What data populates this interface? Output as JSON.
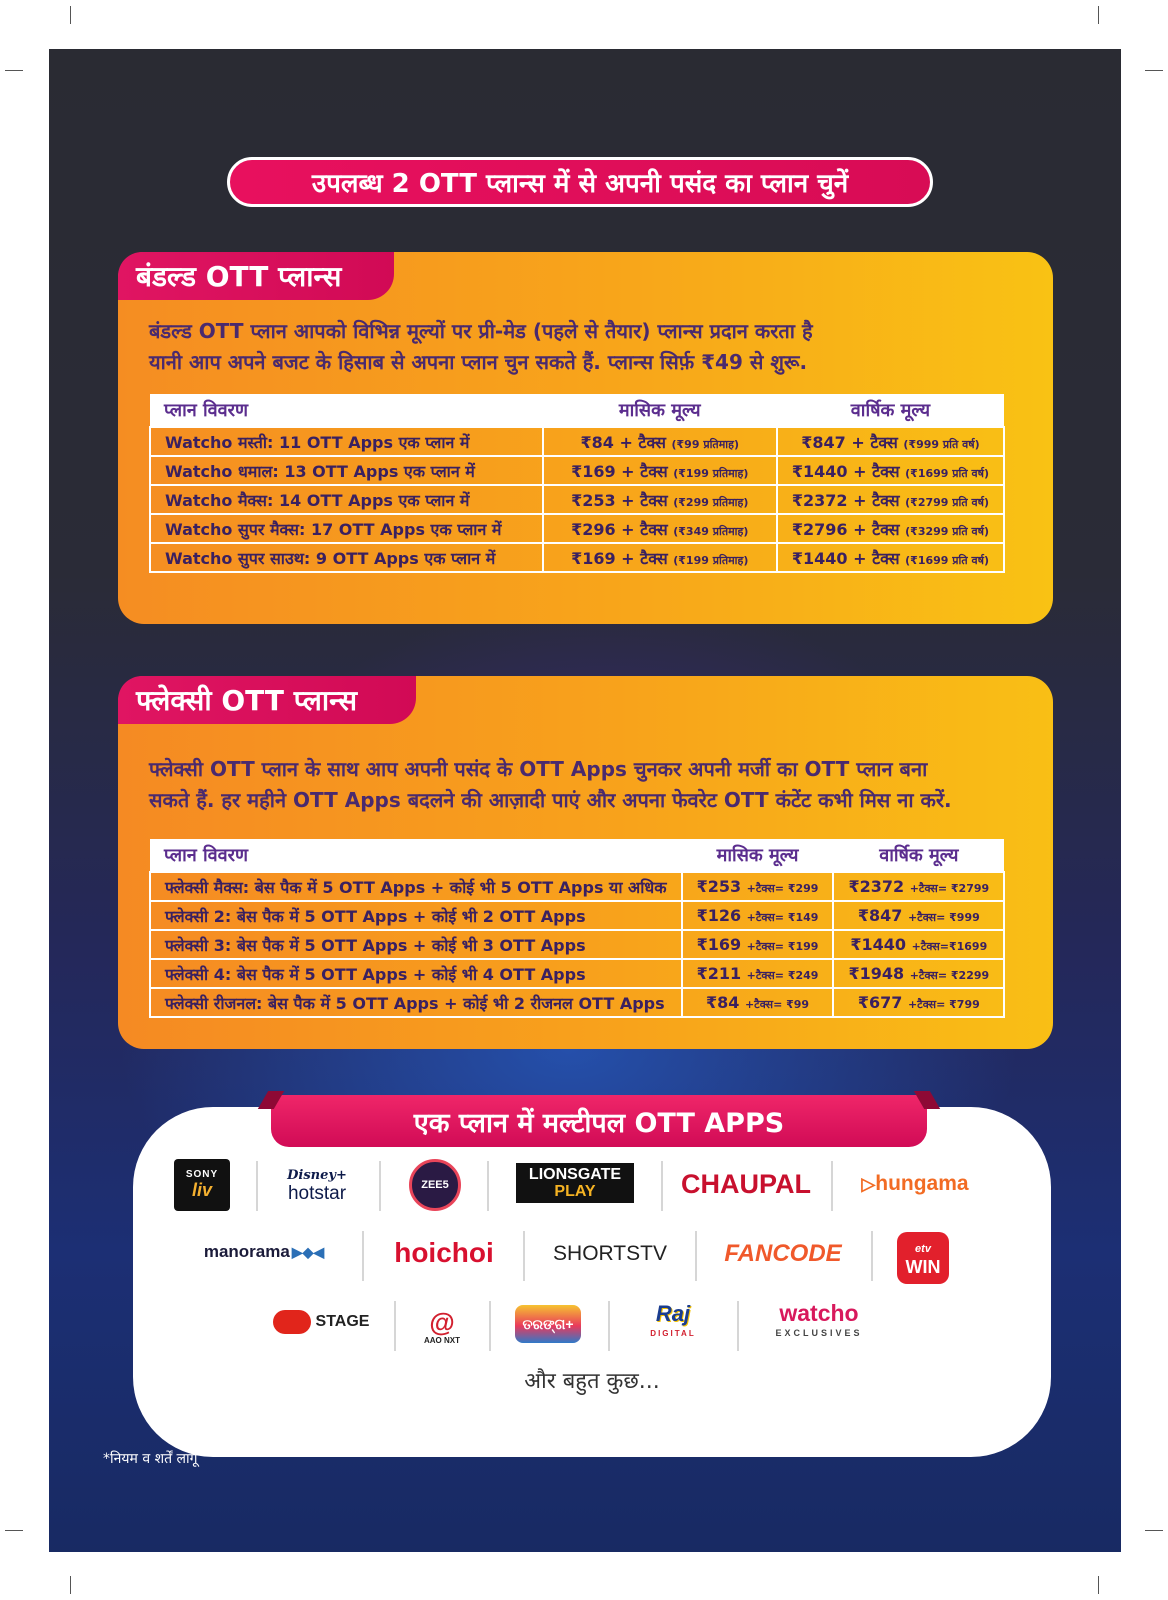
{
  "headline": "उपलब्ध 2 OTT प्लान्स में से अपनी पसंद का प्लान चुनें",
  "bundled": {
    "tag": "बंडल्ड OTT प्लान्स",
    "desc_line1": "बंडल्ड OTT प्लान आपको विभिन्न मूल्यों पर प्री-मेड (पहले से तैयार) प्लान्स प्रदान करता है",
    "desc_line2": "यानी आप अपने बजट के हिसाब से अपना प्लान चुन सकते हैं. प्लान्स सिर्फ़ ₹49 से शुरू.",
    "headers": [
      "प्लान विवरण",
      "मासिक मूल्य",
      "वार्षिक मूल्य"
    ],
    "rows": [
      {
        "plan": "Watcho मस्ती: 11 OTT Apps एक प्लान में",
        "monthly": "₹84 + टैक्स",
        "monthly_note": "(₹99 प्रतिमाह)",
        "yearly": "₹847 + टैक्स",
        "yearly_note": "(₹999 प्रति वर्ष)"
      },
      {
        "plan": "Watcho धमाल: 13 OTT Apps एक प्लान में",
        "monthly": "₹169 + टैक्स",
        "monthly_note": "(₹199 प्रतिमाह)",
        "yearly": "₹1440 + टैक्स",
        "yearly_note": "(₹1699 प्रति वर्ष)"
      },
      {
        "plan": "Watcho मैक्स: 14 OTT Apps एक प्लान में",
        "monthly": "₹253 + टैक्स",
        "monthly_note": "(₹299 प्रतिमाह)",
        "yearly": "₹2372 + टैक्स",
        "yearly_note": "(₹2799 प्रति वर्ष)"
      },
      {
        "plan": "Watcho सुपर मैक्स: 17 OTT Apps एक प्लान में",
        "monthly": "₹296 + टैक्स",
        "monthly_note": "(₹349 प्रतिमाह)",
        "yearly": "₹2796 + टैक्स",
        "yearly_note": "(₹3299 प्रति वर्ष)"
      },
      {
        "plan": "Watcho सुपर साउथ: 9 OTT Apps एक प्लान में",
        "monthly": "₹169 + टैक्स",
        "monthly_note": "(₹199 प्रतिमाह)",
        "yearly": "₹1440 + टैक्स",
        "yearly_note": "(₹1699 प्रति वर्ष)"
      }
    ]
  },
  "flexi": {
    "tag": "फ्लेक्सी OTT प्लान्स",
    "desc_line1": "फ्लेक्सी OTT प्लान के साथ आप अपनी पसंद के OTT Apps चुनकर अपनी मर्जी का OTT प्लान बना",
    "desc_line2": "सकते हैं. हर महीने OTT Apps बदलने की आज़ादी पाएं और अपना फेवरेट OTT कंटेंट कभी मिस ना करें.",
    "headers": [
      "प्लान विवरण",
      "मासिक मूल्य",
      "वार्षिक मूल्य"
    ],
    "rows": [
      {
        "plan": "फ्लेक्सी मैक्स: बेस पैक में 5 OTT Apps + कोई भी 5 OTT Apps या अधिक",
        "monthly": "₹253",
        "monthly_note": "+टैक्स= ₹299",
        "yearly": "₹2372",
        "yearly_note": "+टैक्स= ₹2799"
      },
      {
        "plan": "फ्लेक्सी 2: बेस पैक में 5 OTT Apps + कोई भी 2 OTT Apps",
        "monthly": "₹126",
        "monthly_note": "+टैक्स= ₹149",
        "yearly": "₹847",
        "yearly_note": "+टैक्स= ₹999"
      },
      {
        "plan": "फ्लेक्सी 3: बेस पैक में 5 OTT Apps + कोई भी 3 OTT Apps",
        "monthly": "₹169",
        "monthly_note": "+टैक्स= ₹199",
        "yearly": "₹1440",
        "yearly_note": "+टैक्स=₹1699"
      },
      {
        "plan": "फ्लेक्सी 4: बेस पैक में 5 OTT Apps + कोई भी 4 OTT Apps",
        "monthly": "₹211",
        "monthly_note": "+टैक्स= ₹249",
        "yearly": "₹1948",
        "yearly_note": "+टैक्स= ₹2299"
      },
      {
        "plan": "फ्लेक्सी रीजनल: बेस पैक में 5 OTT Apps + कोई भी 2 रीजनल OTT Apps",
        "monthly": "₹84",
        "monthly_note": "+टैक्स= ₹99",
        "yearly": "₹677",
        "yearly_note": "+टैक्स= ₹799"
      }
    ]
  },
  "apps": {
    "ribbon": "एक प्लान में मल्टीपल OTT APPS",
    "logos": {
      "sonyliv_top": "SONY",
      "sonyliv_bottom": "liv",
      "hotstar_top": "Disney+",
      "hotstar_bottom": "hotstar",
      "zee5": "ZEE5",
      "lionsgate_top": "LIONSGATE",
      "lionsgate_bottom": "PLAY",
      "chaupal": "CHAUPAL",
      "hungama": "hungama",
      "manorama": "manorama",
      "hoichoi": "hoichoi",
      "shortstv": "SHORTSTV",
      "fancode": "FANCODE",
      "etvwin_top": "etv",
      "etvwin_bottom": "WIN",
      "stage": "STAGE",
      "aaonxt": "AAO NXT",
      "tarang": "ତରଙ୍ଗ+",
      "raj_top": "Raj",
      "raj_bottom": "DIGITAL",
      "watcho_top": "watcho",
      "watcho_bottom": "EXCLUSIVES"
    },
    "more": "और बहुत कुछ..."
  },
  "footnote": "*नियम व शर्तें लागू",
  "colors": {
    "pink": "#e0125e",
    "orange": "#f8a21a",
    "purple_text": "#4a2a6e"
  }
}
